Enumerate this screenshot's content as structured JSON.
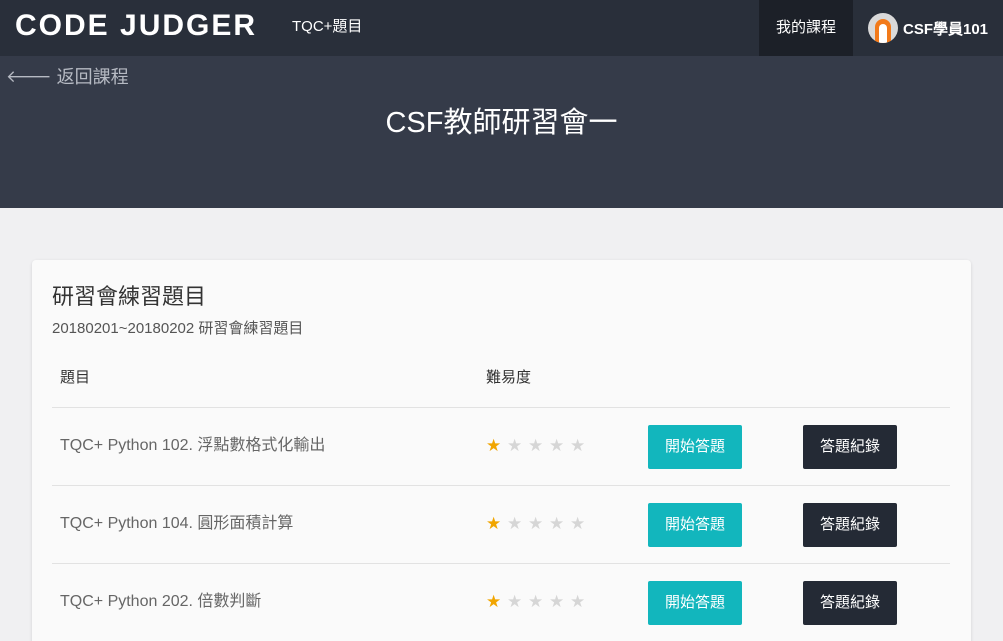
{
  "navbar": {
    "brand": "CODE JUDGER",
    "link": "TQC+題目",
    "active_link": "我的課程",
    "user_name": "CSF學員101"
  },
  "hero": {
    "back_label": "返回課程",
    "title": "CSF教師研習會一"
  },
  "card": {
    "title": "研習會練習題目",
    "subtitle": "20180201~20180202 研習會練習題目",
    "headers": {
      "problem": "題目",
      "difficulty": "難易度"
    },
    "rows": [
      {
        "title": "TQC+ Python 102. 浮點數格式化輸出",
        "difficulty": 1,
        "max_difficulty": 5,
        "start_label": "開始答題",
        "record_label": "答題紀錄"
      },
      {
        "title": "TQC+ Python 104. 圓形面積計算",
        "difficulty": 1,
        "max_difficulty": 5,
        "start_label": "開始答題",
        "record_label": "答題紀錄"
      },
      {
        "title": "TQC+ Python 202. 倍數判斷",
        "difficulty": 1,
        "max_difficulty": 5,
        "start_label": "開始答題",
        "record_label": "答題紀錄"
      }
    ]
  },
  "colors": {
    "navbar_bg": "#292f3a",
    "hero_bg": "#353b49",
    "start_button": "#12b6bd",
    "record_button": "#242a35",
    "star_active": "#f1a500",
    "star_inactive": "#d6d6d6"
  },
  "icons": {
    "back": "arrow-left-icon",
    "avatar": "avatar-icon",
    "difficulty": "star-icon"
  }
}
